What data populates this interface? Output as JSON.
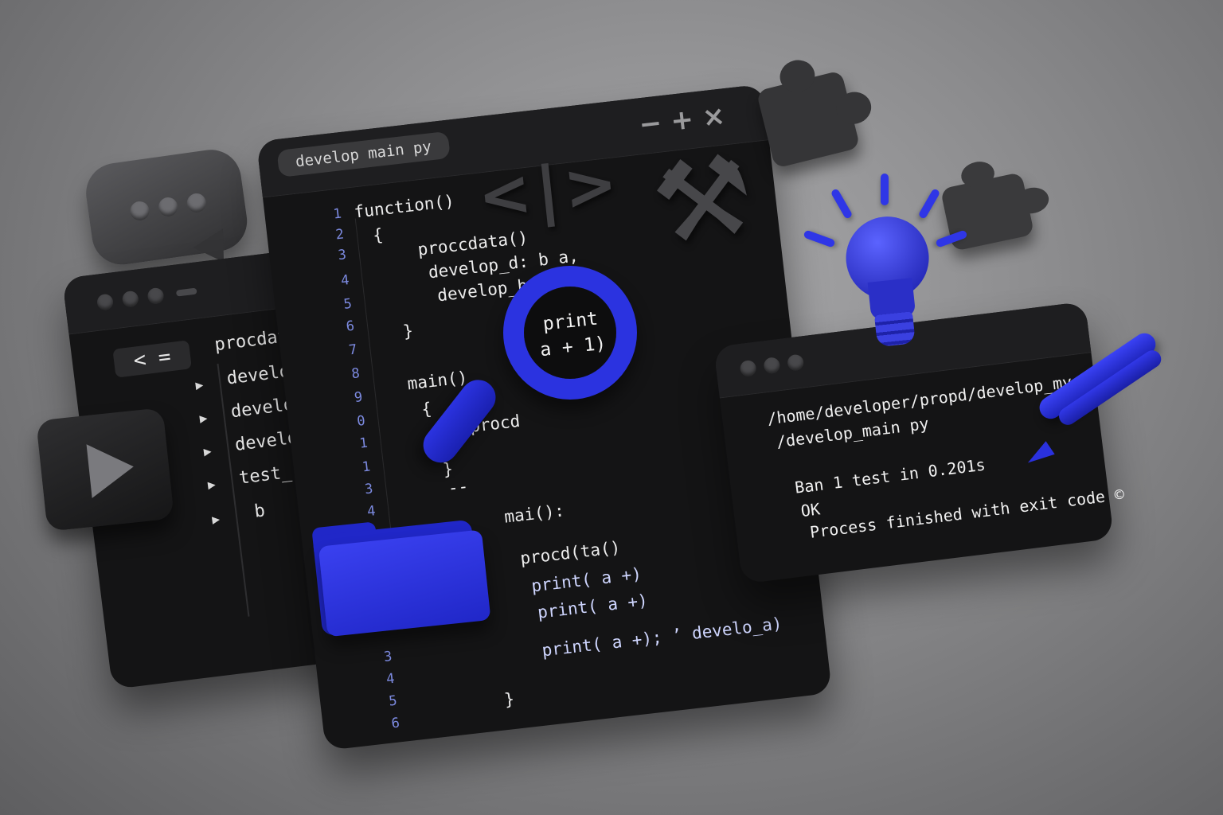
{
  "editor": {
    "tab_title": "develop main py",
    "window_controls": {
      "minimize": "−",
      "maximize": "+",
      "close": "×"
    },
    "line_numbers": [
      "1",
      "2",
      "3",
      "4",
      "5",
      "6",
      "7",
      "8",
      "9",
      "0",
      "1",
      "1",
      "3",
      "4",
      "3",
      "4",
      "5",
      "6"
    ],
    "code_lines": [
      "function()",
      "{",
      "proccdata()",
      "develop_d: b a,",
      "develop_b: +",
      "}",
      "main()",
      "{",
      "procd",
      "}",
      "--",
      "mai():",
      "procd(ta()",
      "print( a +)",
      "print( a +)",
      "print( a +); ’ develo_a)",
      "}"
    ]
  },
  "explorer": {
    "nav_label": "< =",
    "items": [
      "procdata",
      "develop_a",
      "develop_b",
      "develop_c",
      "test_rniin",
      "b"
    ],
    "expand_arrow": "▶"
  },
  "terminal": {
    "lines": [
      "/home/developer/propd/develop_my_test",
      "/develop_main py",
      "",
      "Ban 1 test in 0.201s",
      "OK",
      "Process finished with exit code ©"
    ]
  },
  "magnifier": {
    "lens_text": "print\na + 1)"
  },
  "icons": {
    "code_icon": "<|>",
    "wrench_icon": "⚒",
    "chat_icon": "chat-bubble",
    "play_icon": "play-triangle",
    "folder_icon": "folder",
    "bulb_icon": "light-bulb",
    "pen_icon": "pen",
    "puzzle_icon": "puzzle-piece"
  },
  "colors": {
    "accent_blue": "#2b33e0",
    "window_bg": "#141415",
    "line_number": "#7c8ae0"
  }
}
